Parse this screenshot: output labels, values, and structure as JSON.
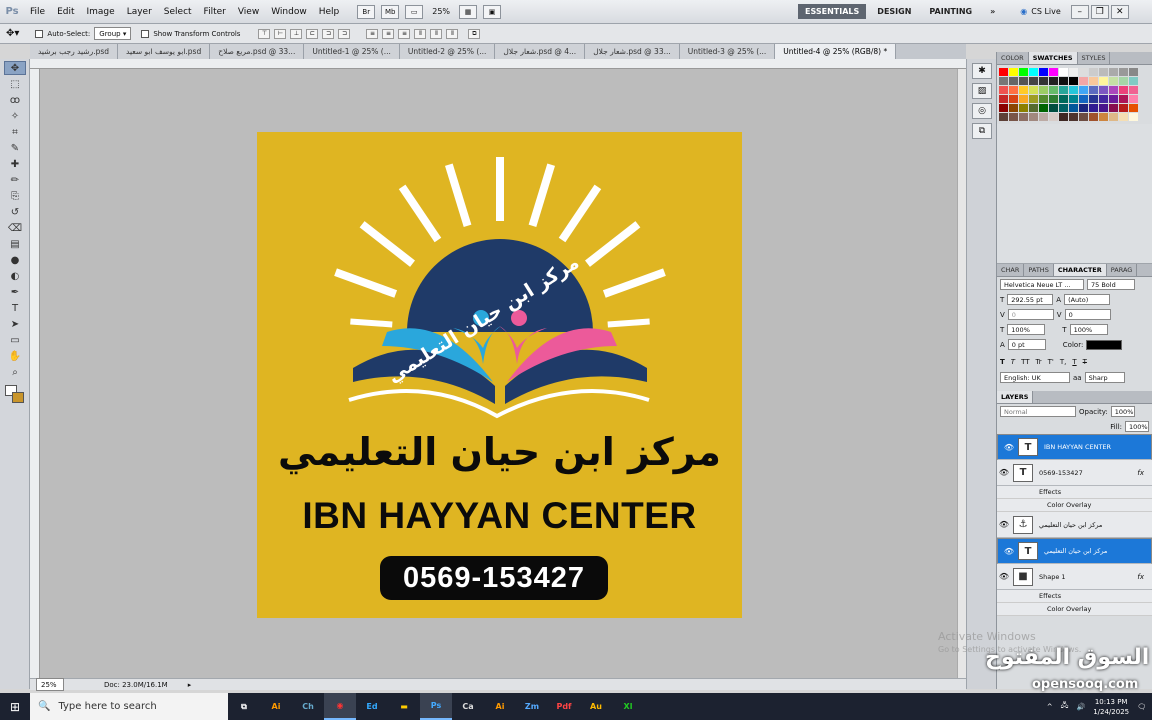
{
  "app": {
    "logo": "Ps"
  },
  "menubar": {
    "items": [
      "File",
      "Edit",
      "Image",
      "Layer",
      "Select",
      "Filter",
      "View",
      "Window",
      "Help"
    ],
    "zoom": "25%",
    "workspaces": [
      "ESSENTIALS",
      "DESIGN",
      "PAINTING"
    ],
    "workspace_more": "»",
    "cslive": "CS Live"
  },
  "options_bar": {
    "auto_select_label": "Auto-Select:",
    "auto_select_value": "Group",
    "show_transform_label": "Show Transform Controls"
  },
  "tabs": [
    {
      "label": "رشيد رجب برشيد.psd",
      "active": false
    },
    {
      "label": "ابو يوسف ابو سعيد.psd",
      "active": false
    },
    {
      "label": "مربع صلاح.psd @ 33...",
      "active": false
    },
    {
      "label": "Untitled-1 @ 25% (...",
      "active": false
    },
    {
      "label": "Untitled-2 @ 25% (...",
      "active": false
    },
    {
      "label": "شعار جلال.psd @ 4...",
      "active": false
    },
    {
      "label": "شعار جلال.psd @ 33...",
      "active": false
    },
    {
      "label": "Untitled-3 @ 25% (...",
      "active": false
    },
    {
      "label": "Untitled-4 @ 25% (RGB/8) *",
      "active": true
    }
  ],
  "tools": [
    "move-tool",
    "marquee-tool",
    "lasso-tool",
    "quick-select-tool",
    "crop-tool",
    "eyedropper-tool",
    "healing-tool",
    "brush-tool",
    "clone-stamp-tool",
    "history-brush-tool",
    "eraser-tool",
    "gradient-tool",
    "blur-tool",
    "dodge-tool",
    "pen-tool",
    "type-tool",
    "path-select-tool",
    "shape-tool",
    "hand-tool",
    "zoom-tool"
  ],
  "artwork": {
    "arc_text": "مركز ابن حيان التعليمي",
    "arabic_title": "مركز ابن حيان التعليمي",
    "english_title": "IBN HAYYAN CENTER",
    "phone": "0569-153427",
    "colors": {
      "background": "#dfb522",
      "navy": "#1f3a68",
      "cyan": "#2aa7dc",
      "pink": "#ec5a9a",
      "white": "#ffffff"
    }
  },
  "status": {
    "zoom": "25%",
    "doc": "Doc: 23.0M/16.1M"
  },
  "panels": {
    "color_tabs": [
      "COLOR",
      "SWATCHES",
      "STYLES"
    ],
    "swatches": [
      "#ff0000",
      "#ffff00",
      "#00ff00",
      "#00ffff",
      "#0000ff",
      "#ff00ff",
      "#ffffff",
      "#eeeeee",
      "#dddddd",
      "#cccccc",
      "#bbbbbb",
      "#aaaaaa",
      "#999999",
      "#888888",
      "#777777",
      "#666666",
      "#555555",
      "#444444",
      "#333333",
      "#222222",
      "#111111",
      "#000000",
      "#f4a6a6",
      "#f9c89b",
      "#fff59d",
      "#c5e1a5",
      "#a5d6a7",
      "#80cbc4",
      "#ef5350",
      "#ff7043",
      "#ffca28",
      "#d4e157",
      "#9ccc65",
      "#66bb6a",
      "#26a69a",
      "#26c6da",
      "#42a5f5",
      "#5c6bc0",
      "#7e57c2",
      "#ab47bc",
      "#ec407a",
      "#f06292",
      "#c62828",
      "#d84315",
      "#f9a825",
      "#9e9d24",
      "#558b2f",
      "#2e7d32",
      "#00695c",
      "#00838f",
      "#1565c0",
      "#283593",
      "#4527a0",
      "#6a1b9a",
      "#ad1457",
      "#ff80ab",
      "#8b0000",
      "#8b4500",
      "#8b8000",
      "#556b2f",
      "#006400",
      "#004d40",
      "#006064",
      "#01579b",
      "#1a237e",
      "#311b92",
      "#4a148c",
      "#880e4f",
      "#b71c1c",
      "#e65100",
      "#5d4037",
      "#795548",
      "#8d6e63",
      "#a1887f",
      "#bcaaa4",
      "#d7ccc8",
      "#3e2723",
      "#4e342e",
      "#6d4c41",
      "#a0522d",
      "#cd853f",
      "#deb887",
      "#f5deb3",
      "#fff8dc"
    ],
    "char_tabs": [
      "CHAR",
      "PATHS",
      "CHARACTER",
      "PARAG"
    ],
    "character": {
      "font": "Helvetica Neue LT ...",
      "style": "75 Bold",
      "size": "292.55 pt",
      "leading": "(Auto)",
      "kerning": "0",
      "tracking": "0",
      "vscale": "100%",
      "hscale": "100%",
      "baseline": "0 pt",
      "color_label": "Color:",
      "color": "#000000",
      "language": "English: UK",
      "aa": "Sharp",
      "style_buttons": [
        "T",
        "T",
        "TT",
        "Tr",
        "T'",
        "T,",
        "T",
        "T"
      ]
    },
    "layers": {
      "tab": "LAYERS",
      "blend": "Normal",
      "opacity_label": "Opacity:",
      "opacity": "100%",
      "fill_label": "Fill:",
      "fill": "100%",
      "items": [
        {
          "name": "IBN HAYYAN CENTER",
          "type": "T",
          "selected": true,
          "fx": false
        },
        {
          "name": "0569-153427",
          "type": "T",
          "selected": false,
          "fx": true
        },
        {
          "name": "مركز ابن حيان التعليمي",
          "type": "⚓",
          "selected": false,
          "fx": false
        },
        {
          "name": "مركز ابن حيان التعليمي",
          "type": "T",
          "selected": true,
          "fx": false
        },
        {
          "name": "Shape 1",
          "type": "■",
          "selected": false,
          "fx": true
        }
      ],
      "effects_label": "Effects",
      "color_overlay": "Color Overlay"
    }
  },
  "watermark": {
    "activate": "Activate Windows",
    "go": "Go to Settings to activate Windows.",
    "logo": "السوق المفتوح",
    "sub": "opensooq.com"
  },
  "taskbar": {
    "search": "Type here to search",
    "apps": [
      "Ai",
      "Ch",
      "Ed",
      "Fe",
      "Ps",
      "Ca",
      "Ai",
      "Zm",
      "Pdf",
      "Au",
      "Xl"
    ],
    "time": "10:13 PM",
    "date": "1/24/2025"
  }
}
